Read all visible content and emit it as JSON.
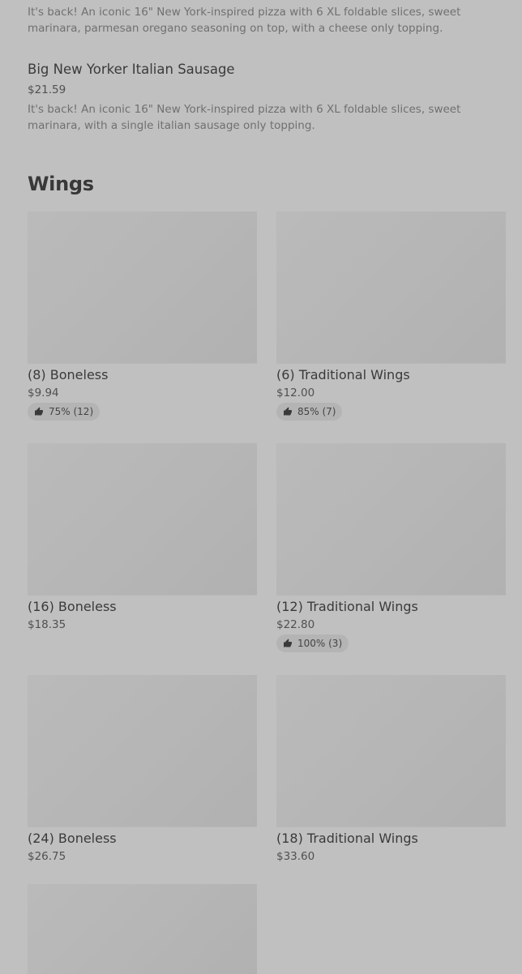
{
  "top_description": "It's back! An iconic 16\" New York-inspired pizza with 6 XL foldable slices, sweet marinara, parmesan oregano seasoning on top, with a cheese only topping.",
  "sausage_item": {
    "title": "Big New Yorker Italian Sausage",
    "price": "$21.59",
    "description": "It's back! An iconic 16\" New York-inspired pizza with 6 XL foldable slices, sweet marinara, with a single italian sausage only topping."
  },
  "wings_section": {
    "title": "Wings",
    "items": [
      {
        "title": "(8) Boneless",
        "price": "$9.94",
        "rating": "75% (12)"
      },
      {
        "title": "(6) Traditional Wings",
        "price": "$12.00",
        "rating": "85% (7)"
      },
      {
        "title": "(16) Boneless",
        "price": "$18.35",
        "rating": ""
      },
      {
        "title": "(12) Traditional Wings",
        "price": "$22.80",
        "rating": "100% (3)"
      },
      {
        "title": "(24) Boneless",
        "price": "$26.75",
        "rating": ""
      },
      {
        "title": "(18) Traditional Wings",
        "price": "$33.60",
        "rating": ""
      }
    ]
  },
  "icons": {
    "rating": "thumbs-up-icon"
  }
}
